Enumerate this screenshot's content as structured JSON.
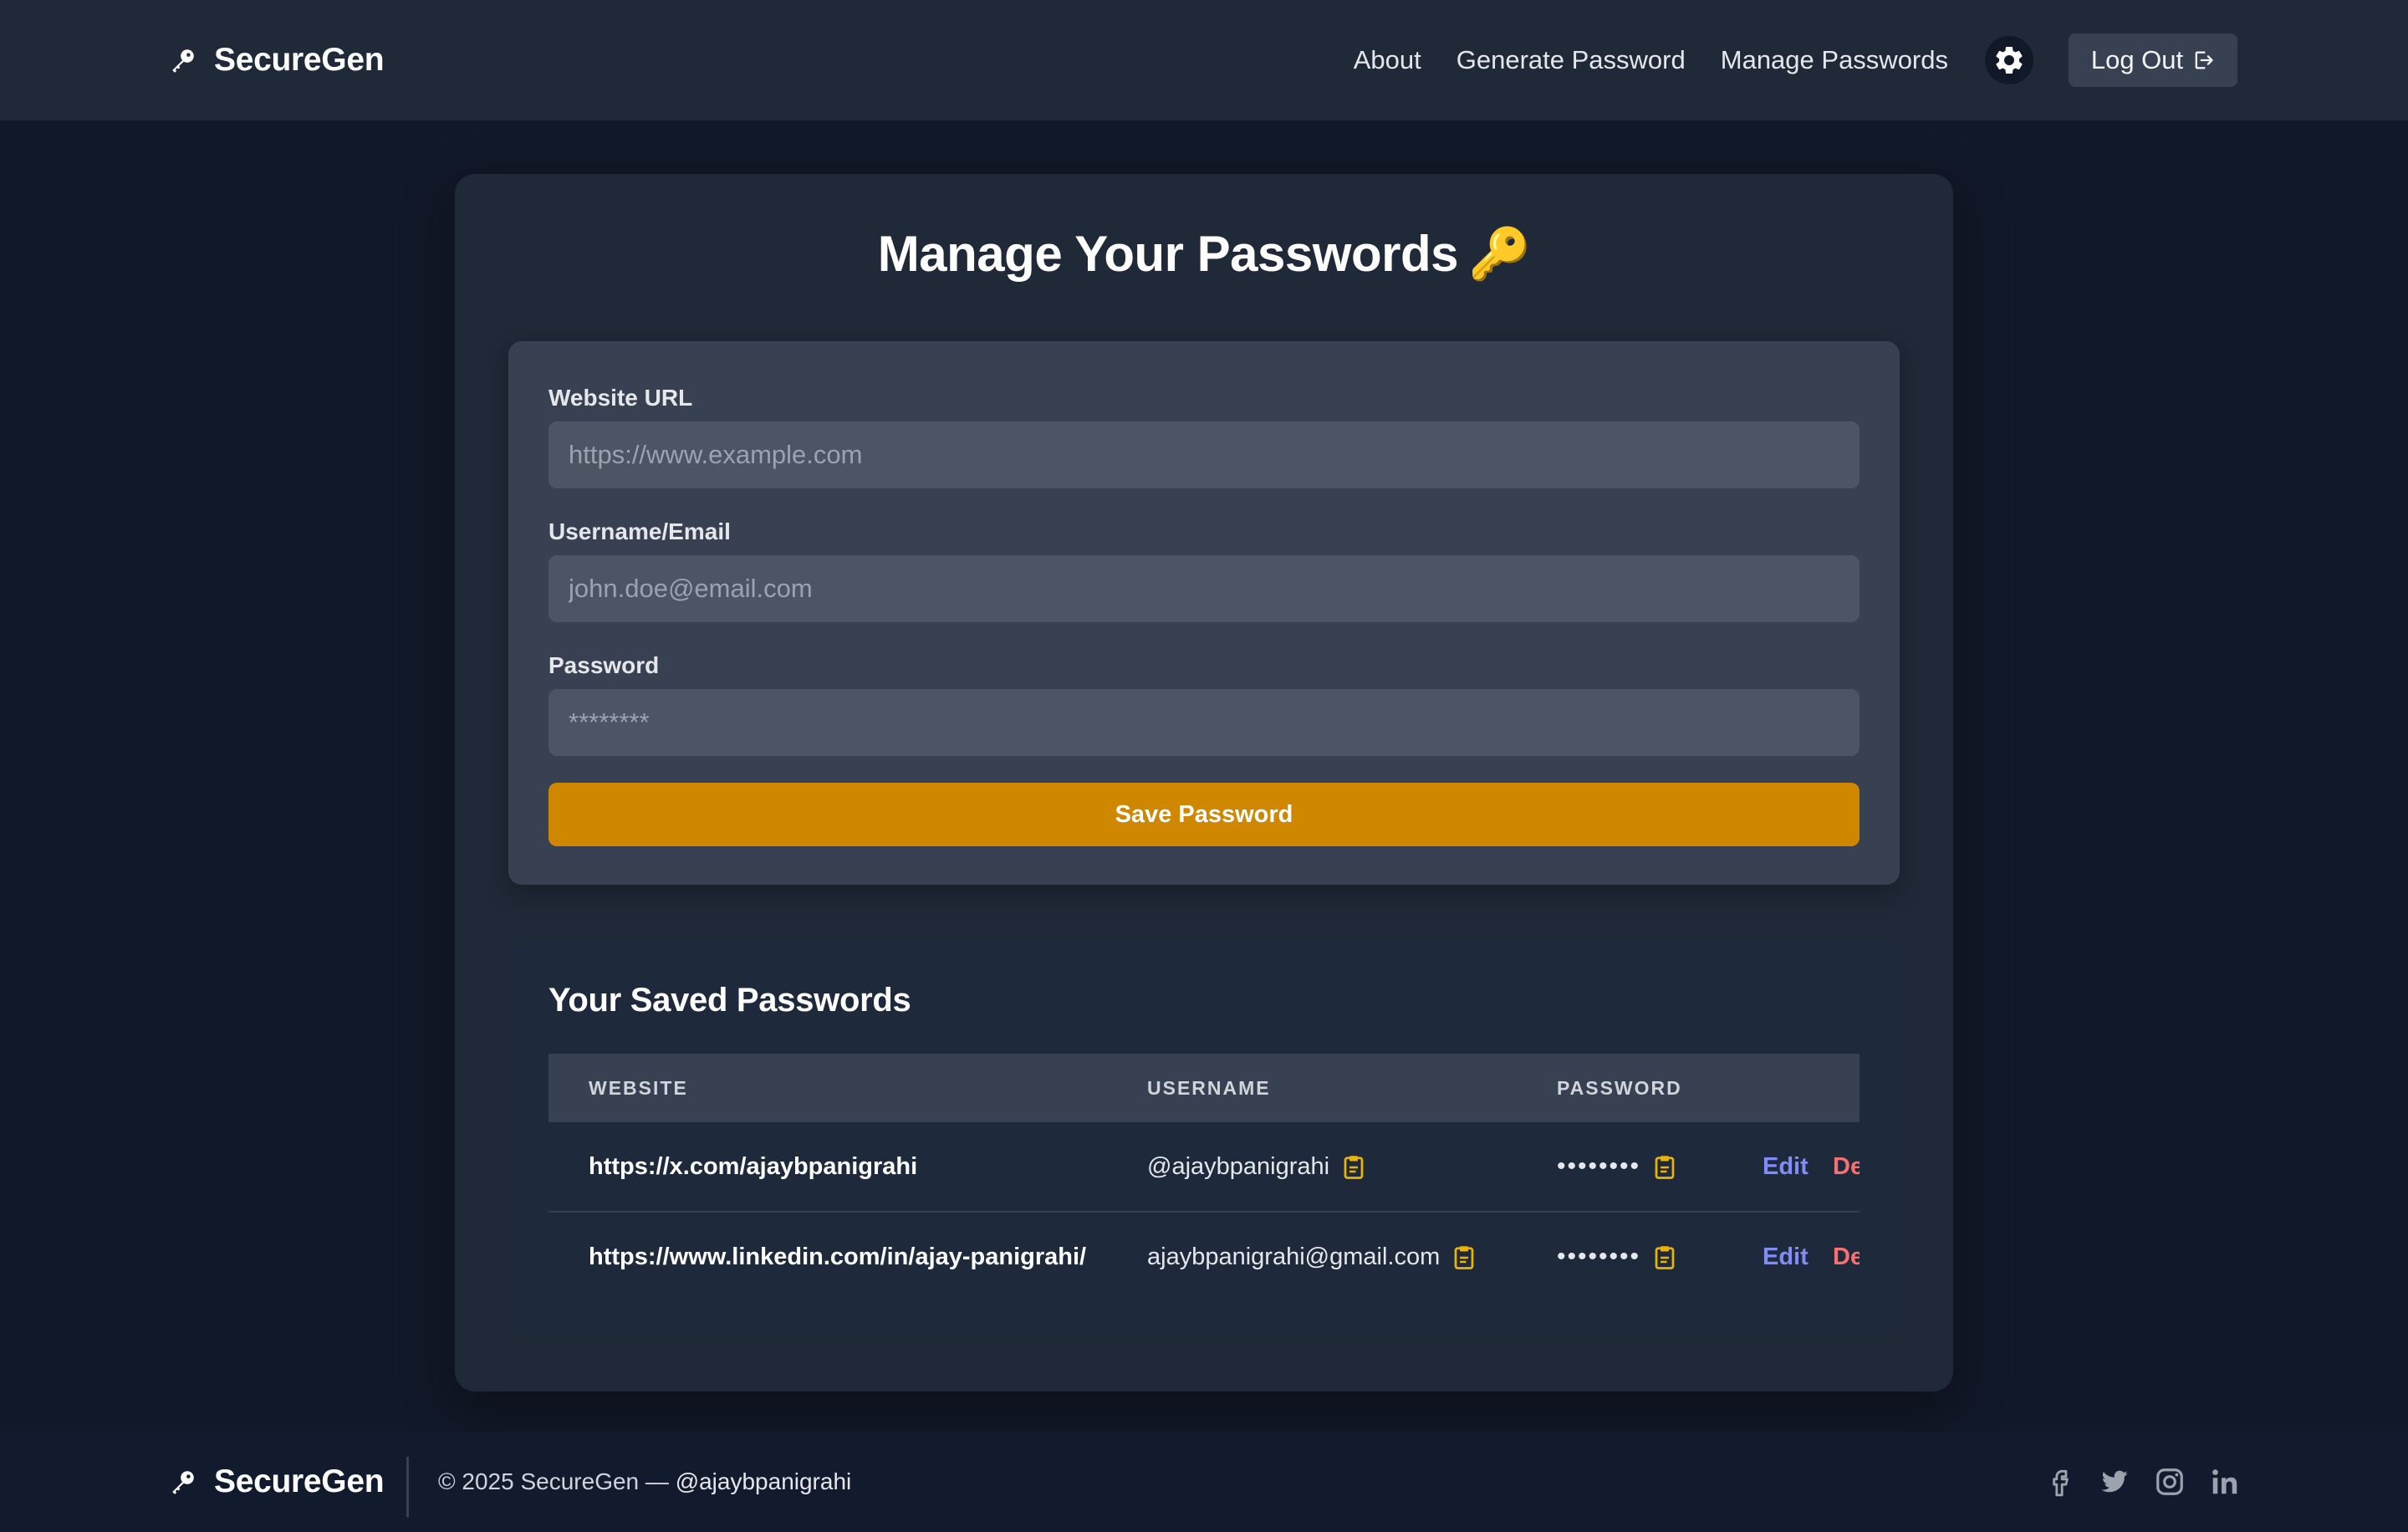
{
  "header": {
    "brand": "SecureGen",
    "nav": [
      "About",
      "Generate Password",
      "Manage Passwords"
    ],
    "logout_label": "Log Out"
  },
  "page": {
    "title": "Manage Your Passwords",
    "title_emoji": "🔑"
  },
  "form": {
    "url_label": "Website URL",
    "url_placeholder": "https://www.example.com",
    "username_label": "Username/Email",
    "username_placeholder": "john.doe@email.com",
    "password_label": "Password",
    "password_placeholder": "********",
    "save_label": "Save Password"
  },
  "saved": {
    "title": "Your Saved Passwords",
    "columns": [
      "WEBSITE",
      "USERNAME",
      "PASSWORD"
    ],
    "rows": [
      {
        "website": "https://x.com/ajaybpanigrahi",
        "username": "@ajaybpanigrahi",
        "password": "••••••••",
        "edit": "Edit",
        "delete": "De"
      },
      {
        "website": "https://www.linkedin.com/in/ajay-panigrahi/",
        "username": "ajaybpanigrahi@gmail.com",
        "password": "••••••••",
        "edit": "Edit",
        "delete": "De"
      }
    ]
  },
  "footer": {
    "brand": "SecureGen",
    "copyright": "© 2025 SecureGen — ",
    "handle": "@ajaybpanigrahi",
    "socials": [
      "facebook-icon",
      "twitter-icon",
      "instagram-icon",
      "linkedin-icon"
    ]
  },
  "colors": {
    "background": "#111827",
    "navbar": "#1f2937",
    "accent": "#d08700",
    "edit": "#818cf8",
    "delete": "#f87171"
  }
}
